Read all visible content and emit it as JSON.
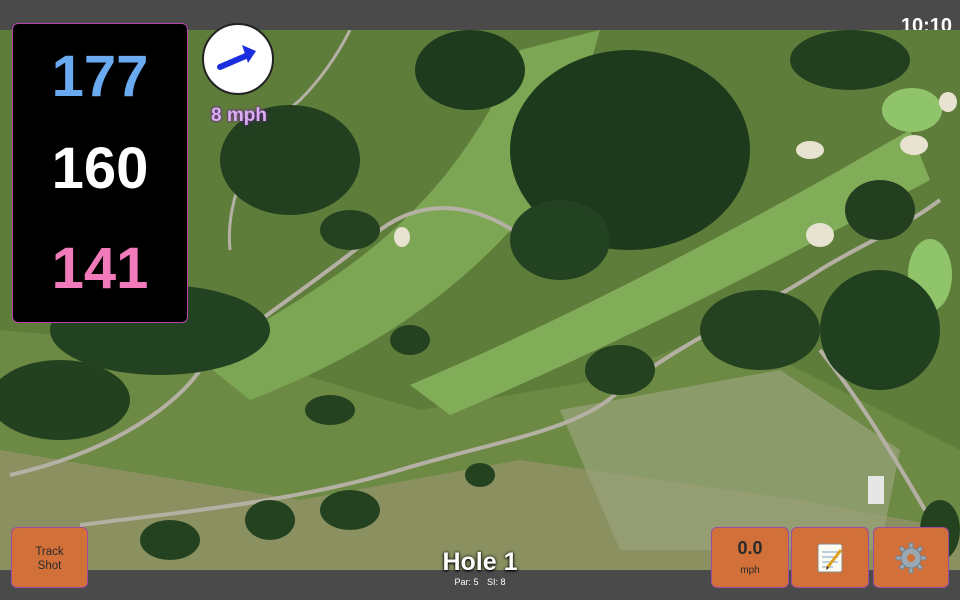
{
  "status_bar": {
    "time": "10:10"
  },
  "distances": {
    "back": "177",
    "middle": "160",
    "front": "141"
  },
  "wind": {
    "speed": "8 mph",
    "direction_icon": "arrow-icon"
  },
  "buttons": {
    "track_shot_line1": "Track",
    "track_shot_line2": "Shot",
    "speed_value": "0.0",
    "speed_unit": "mph",
    "notes_icon": "notepad-icon",
    "settings_icon": "gear-icon"
  },
  "hole": {
    "title": "Hole 1",
    "par_label": "Par: 5",
    "si_label": "SI: 8"
  },
  "colors": {
    "back_distance": "#6aaaf0",
    "middle_distance": "#ffffff",
    "front_distance": "#f07aba",
    "button_bg": "#d2703a",
    "wind_text": "#d9b0f0"
  }
}
